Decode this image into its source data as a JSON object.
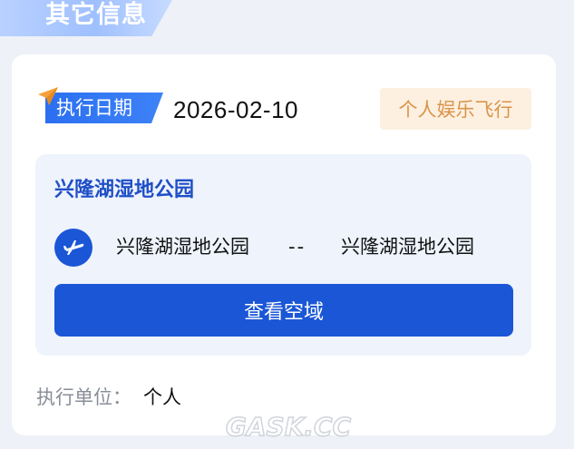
{
  "section": {
    "title": "其它信息"
  },
  "execution": {
    "date_label": "执行日期",
    "date_value": "2026-02-10",
    "flight_type": "个人娱乐飞行"
  },
  "location": {
    "name": "兴隆湖湿地公园",
    "route_from": "兴隆湖湿地公园",
    "route_separator": "--",
    "route_to": "兴隆湖湿地公园",
    "view_airspace_label": "查看空域"
  },
  "unit": {
    "label": "执行单位：",
    "value": "个人"
  },
  "watermark": {
    "text": "GASK.CC"
  },
  "colors": {
    "primary": "#1a56d6",
    "badge_bg": "#fdf0e0",
    "badge_text": "#d9944a",
    "panel_bg": "#eef3fc"
  }
}
